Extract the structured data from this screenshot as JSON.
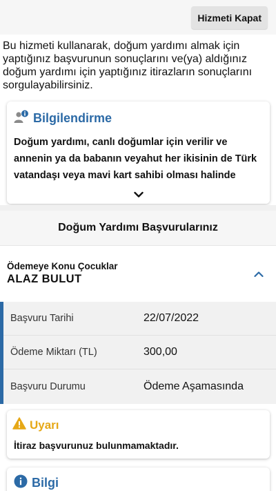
{
  "header": {
    "close_button_label": "Hizmeti Kapat"
  },
  "intro_text": "Bu hizmeti kullanarak, doğum yardımı almak için yaptığınız başvurunun sonuçlarını ve(ya) aldığınız doğum yardımı için yaptığınız itirazların sonuçlarını sorgulayabilirsiniz.",
  "info_box": {
    "icon": "person-info-icon",
    "title": "Bilgilendirme",
    "body": "Doğum yardımı, canlı doğumlar için verilir ve annenin ya da babanın veyahut her ikisinin de Türk vatandaşı veya mavi kart sahibi olması halinde yapılır. Doğum yardımı, anne ve babanın her ikisinin",
    "expand_icon": "chevron-down-icon"
  },
  "section": {
    "title": "Doğum Yardımı Başvurularınız"
  },
  "child": {
    "label": "Ödemeye Konu Çocuklar",
    "name": "ALAZ  BULUT",
    "toggle_icon": "chevron-up-icon"
  },
  "details": [
    {
      "label": "Başvuru Tarihi",
      "value": "22/07/2022"
    },
    {
      "label": "Ödeme Miktarı (TL)",
      "value": "300,00"
    },
    {
      "label": "Başvuru Durumu",
      "value": "Ödeme Aşamasında"
    }
  ],
  "warning": {
    "icon": "warning-icon",
    "title": "Uyarı",
    "body": "İtiraz başvurunuz bulunmamaktadır."
  },
  "bilgi": {
    "icon": "info-circle-icon",
    "title": "Bilgi"
  },
  "colors": {
    "accent": "#2c6aa6",
    "warning": "#e6a817"
  }
}
